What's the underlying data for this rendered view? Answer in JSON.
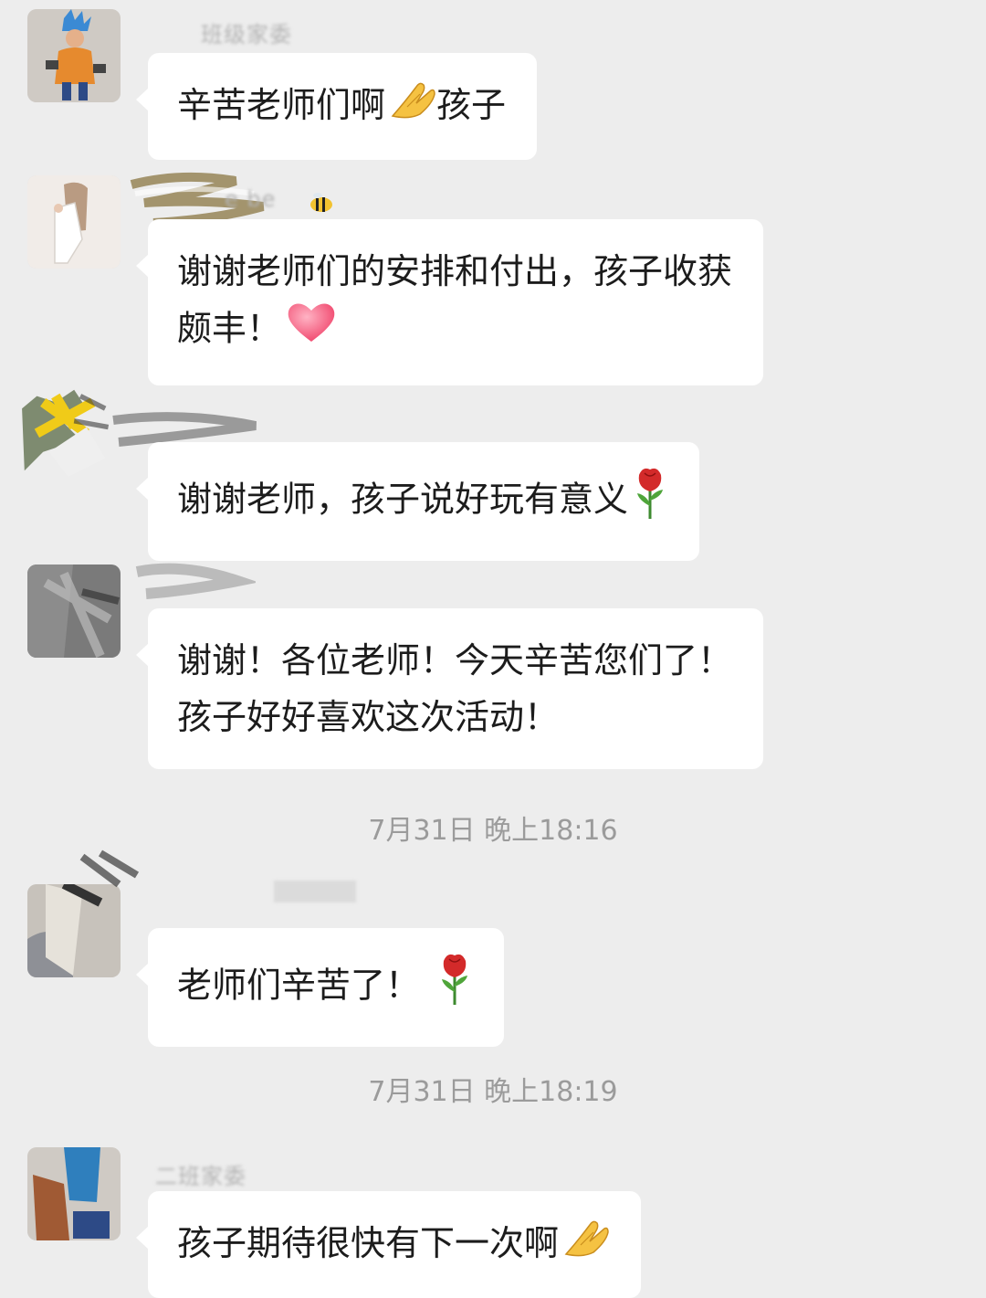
{
  "colors": {
    "background": "#ededed",
    "bubble": "#ffffff",
    "text": "#1c1c1c",
    "timestamp": "#9b9b9b"
  },
  "messages": [
    {
      "sender": "班级家委",
      "lines": [
        "辛苦老师们啊",
        "孩子"
      ],
      "emoji": "folded-hands-icon"
    },
    {
      "sender": "e be",
      "lines": [
        "谢谢老师们的安排和付出，孩子收获",
        "颇丰！"
      ],
      "emoji": "heart-icon"
    },
    {
      "sender": "",
      "lines": [
        "谢谢老师，孩子说好玩有意义"
      ],
      "emoji": "rose-icon"
    },
    {
      "sender": "",
      "lines": [
        "谢谢！各位老师！今天辛苦您们了！",
        "孩子好好喜欢这次活动！"
      ],
      "emoji": ""
    },
    {
      "sender": "",
      "lines": [
        "老师们辛苦了！"
      ],
      "emoji": "rose-icon"
    },
    {
      "sender": "二班家委",
      "lines": [
        "孩子期待很快有下一次啊"
      ],
      "emoji": "folded-hands-icon"
    }
  ],
  "timestamps": [
    "7月31日 晚上18:16",
    "7月31日 晚上18:19"
  ]
}
